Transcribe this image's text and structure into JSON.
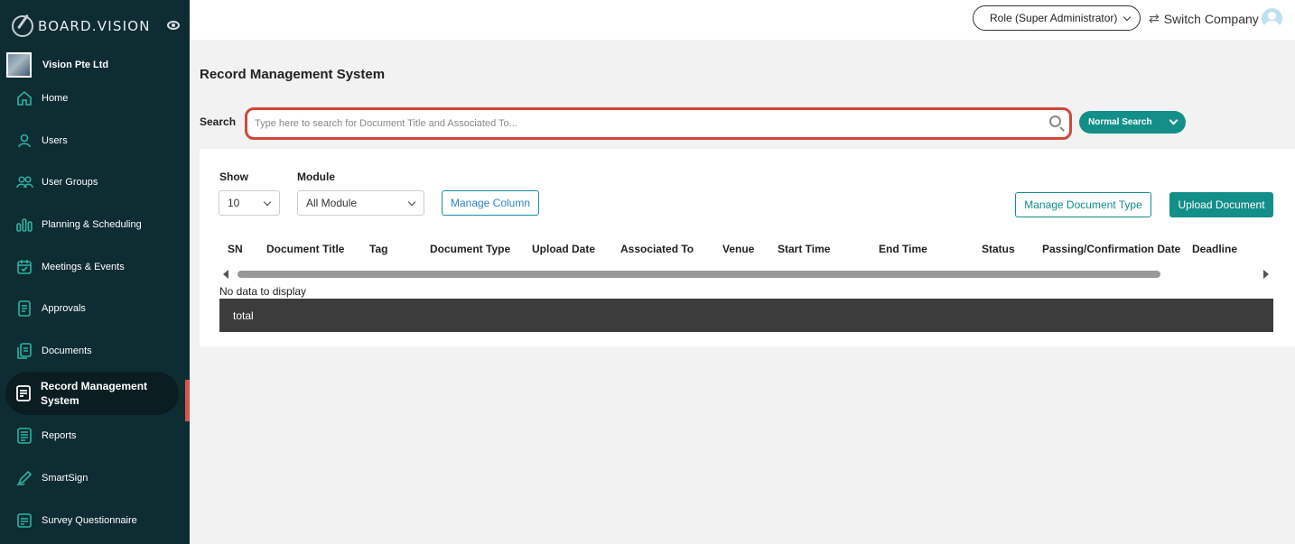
{
  "brand": {
    "name": "BOARD.VISION",
    "company": "Vision Pte Ltd"
  },
  "sidebar": {
    "items": [
      {
        "label": "Home",
        "icon": "home-icon"
      },
      {
        "label": "Users",
        "icon": "user-icon"
      },
      {
        "label": "User Groups",
        "icon": "users-icon"
      },
      {
        "label": "Planning & Scheduling",
        "icon": "bar-chart-icon"
      },
      {
        "label": "Meetings & Events",
        "icon": "calendar-icon"
      },
      {
        "label": "Approvals",
        "icon": "approval-doc-icon"
      },
      {
        "label": "Documents",
        "icon": "documents-icon"
      },
      {
        "label": "Record Management System",
        "icon": "record-icon",
        "active": true
      },
      {
        "label": "Reports",
        "icon": "report-list-icon"
      },
      {
        "label": "SmartSign",
        "icon": "pen-icon"
      },
      {
        "label": "Survey Questionnaire",
        "icon": "survey-icon"
      }
    ]
  },
  "header": {
    "role": "Role (Super Administrator)",
    "switch_company": "Switch Company"
  },
  "page": {
    "title": "Record Management System",
    "search_label": "Search",
    "search_placeholder": "Type here to search for Document Title and Associated To...",
    "search_mode": "Normal Search"
  },
  "controls": {
    "show_label": "Show",
    "show_value": "10",
    "module_label": "Module",
    "module_value": "All Module",
    "manage_column": "Manage Column",
    "manage_doc_type": "Manage Document Type",
    "upload_document": "Upload Document"
  },
  "table": {
    "columns": [
      "SN",
      "Document Title",
      "Tag",
      "Document Type",
      "Upload Date",
      "Associated To",
      "Venue",
      "Start Time",
      "End Time",
      "Status",
      "Passing/Confirmation Date",
      "Deadline"
    ],
    "empty_message": "No data to display",
    "footer_label": "total"
  },
  "colors": {
    "sidebar_bg": "#0e2d33",
    "accent": "#138f8a",
    "highlight": "#d2473a"
  }
}
